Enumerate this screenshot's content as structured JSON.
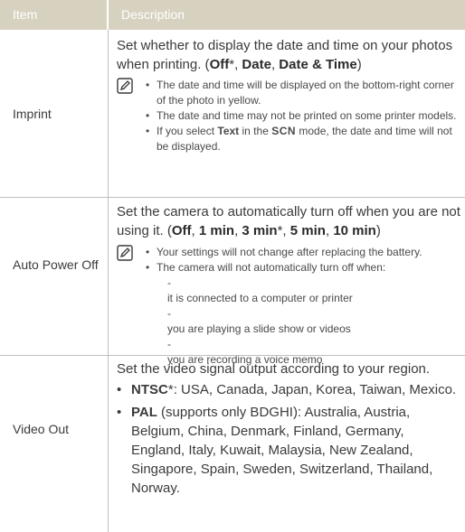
{
  "header": {
    "item": "Item",
    "description": "Description"
  },
  "rows": [
    {
      "item": "Imprint",
      "desc_prefix": "Set whether to display the date and time on your photos when printing. (",
      "options": [
        "Off",
        "Date",
        "Date & Time"
      ],
      "notes": [
        "The date and time will be displayed on the bottom-right corner of the photo in yellow.",
        "The date and time may not be printed on some printer models.",
        {
          "pre": "If you select ",
          "bold": "Text",
          "mid": " in the ",
          "mode": "SCN",
          "post": " mode, the date and time will not be displayed."
        }
      ]
    },
    {
      "item": "Auto Power Off",
      "desc_prefix": "Set the camera to automatically turn off when you are not using it. (",
      "options": [
        "Off",
        "1 min",
        "3 min",
        "5 min",
        "10 min"
      ],
      "notes": [
        "Your settings will not change after replacing the battery.",
        "The camera will not automatically turn off when:"
      ],
      "subnotes": [
        "it is connected to a computer or printer",
        "you are playing a slide show or videos",
        "you are recording a voice memo"
      ]
    },
    {
      "item": "Video Out",
      "desc": "Set the video signal output according to your region.",
      "bullets": [
        {
          "bold": "NTSC",
          "text": ": USA, Canada, Japan, Korea, Taiwan, Mexico."
        },
        {
          "bold": "PAL",
          "text": " (supports only BDGHI): Australia, Austria, Belgium, China, Denmark, Finland, Germany, England, Italy, Kuwait, Malaysia, New Zealand, Singapore, Spain, Sweden, Switzerland, Thailand, Norway."
        }
      ]
    }
  ]
}
